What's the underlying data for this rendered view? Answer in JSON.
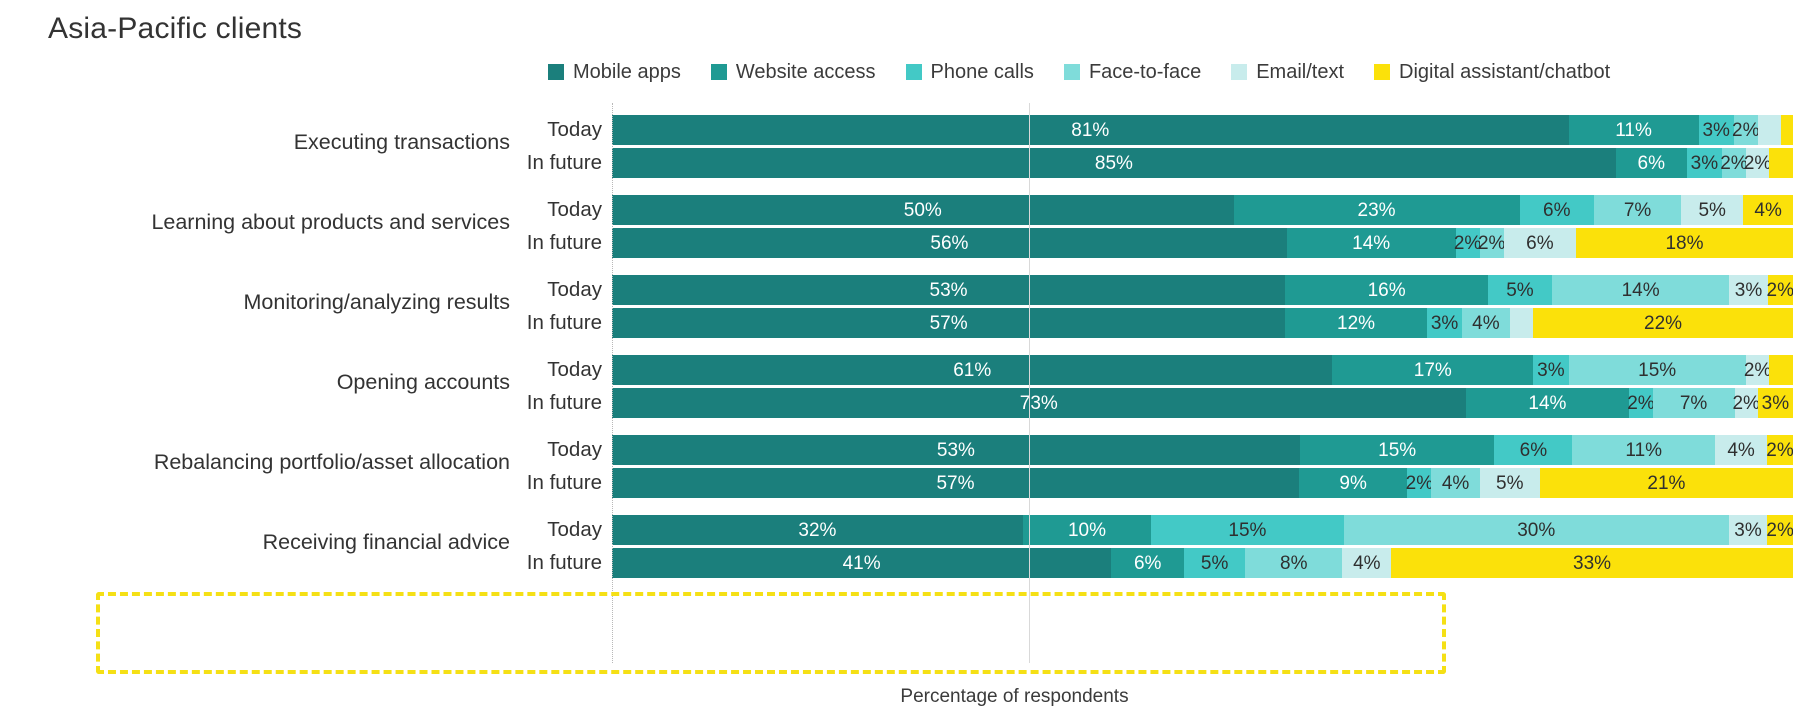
{
  "title": "Asia-Pacific clients",
  "x_axis_title": "Percentage of respondents",
  "row_labels": {
    "today": "Today",
    "future": "In future"
  },
  "legend": [
    {
      "label": "Mobile apps",
      "color": "#1b7f7c"
    },
    {
      "label": "Website access",
      "color": "#1f9a93"
    },
    {
      "label": "Phone calls",
      "color": "#43c9c6"
    },
    {
      "label": "Face-to-face",
      "color": "#7fdcda"
    },
    {
      "label": "Email/text",
      "color": "#c8ecec"
    },
    {
      "label": "Digital assistant/chatbot",
      "color": "#fbe10a"
    }
  ],
  "chart_data": {
    "type": "bar",
    "subtype": "stacked-horizontal-100",
    "title": "Asia-Pacific clients",
    "xlabel": "Percentage of respondents",
    "ylabel": "",
    "xlim": [
      0,
      100
    ],
    "grid": true,
    "legend_position": "top",
    "series": [
      {
        "name": "Mobile apps",
        "color": "#1b7f7c"
      },
      {
        "name": "Website access",
        "color": "#1f9a93"
      },
      {
        "name": "Phone calls",
        "color": "#43c9c6"
      },
      {
        "name": "Face-to-face",
        "color": "#7fdcda"
      },
      {
        "name": "Email/text",
        "color": "#c8ecec"
      },
      {
        "name": "Digital assistant/chatbot",
        "color": "#fbe10a"
      }
    ],
    "groups": [
      {
        "category": "Executing transactions",
        "highlighted": false,
        "rows": [
          {
            "label": "Today",
            "values": [
              81,
              11,
              3,
              2,
              2,
              1
            ],
            "labels": [
              "81%",
              "11%",
              "3%",
              "2%",
              "",
              ""
            ]
          },
          {
            "label": "In future",
            "values": [
              85,
              6,
              3,
              2,
              2,
              2
            ],
            "labels": [
              "85%",
              "6%",
              "3%",
              "2%",
              "2%",
              ""
            ]
          }
        ]
      },
      {
        "category": "Learning about products and services",
        "highlighted": false,
        "rows": [
          {
            "label": "Today",
            "values": [
              50,
              23,
              6,
              7,
              5,
              4
            ],
            "labels": [
              "50%",
              "23%",
              "6%",
              "7%",
              "5%",
              "4%"
            ]
          },
          {
            "label": "In future",
            "values": [
              56,
              14,
              2,
              2,
              6,
              18
            ],
            "labels": [
              "56%",
              "14%",
              "2%",
              "2%",
              "6%",
              "18%"
            ]
          }
        ]
      },
      {
        "category": "Monitoring/analyzing results",
        "highlighted": false,
        "rows": [
          {
            "label": "Today",
            "values": [
              53,
              16,
              5,
              14,
              3,
              2
            ],
            "labels": [
              "53%",
              "16%",
              "5%",
              "14%",
              "3%",
              "2%"
            ]
          },
          {
            "label": "In future",
            "values": [
              57,
              12,
              3,
              4,
              2,
              22
            ],
            "labels": [
              "57%",
              "12%",
              "3%",
              "4%",
              "",
              "22%"
            ]
          }
        ]
      },
      {
        "category": "Opening accounts",
        "highlighted": false,
        "rows": [
          {
            "label": "Today",
            "values": [
              61,
              17,
              3,
              15,
              2,
              2
            ],
            "labels": [
              "61%",
              "17%",
              "3%",
              "15%",
              "2%",
              ""
            ]
          },
          {
            "label": "In future",
            "values": [
              73,
              14,
              2,
              7,
              2,
              3
            ],
            "labels": [
              "73%",
              "14%",
              "2%",
              "7%",
              "2%",
              "3%"
            ]
          }
        ]
      },
      {
        "category": "Rebalancing portfolio/asset allocation",
        "highlighted": false,
        "rows": [
          {
            "label": "Today",
            "values": [
              53,
              15,
              6,
              11,
              4,
              2
            ],
            "labels": [
              "53%",
              "15%",
              "6%",
              "11%",
              "4%",
              "2%"
            ]
          },
          {
            "label": "In future",
            "values": [
              57,
              9,
              2,
              4,
              5,
              21
            ],
            "labels": [
              "57%",
              "9%",
              "2%",
              "4%",
              "5%",
              "21%"
            ]
          }
        ]
      },
      {
        "category": "Receiving financial advice",
        "highlighted": true,
        "rows": [
          {
            "label": "Today",
            "values": [
              32,
              10,
              15,
              30,
              3,
              2
            ],
            "labels": [
              "32%",
              "10%",
              "15%",
              "30%",
              "3%",
              "2%"
            ]
          },
          {
            "label": "In future",
            "values": [
              41,
              6,
              5,
              8,
              4,
              33
            ],
            "labels": [
              "41%",
              "6%",
              "5%",
              "8%",
              "4%",
              "33%"
            ]
          }
        ]
      }
    ]
  }
}
